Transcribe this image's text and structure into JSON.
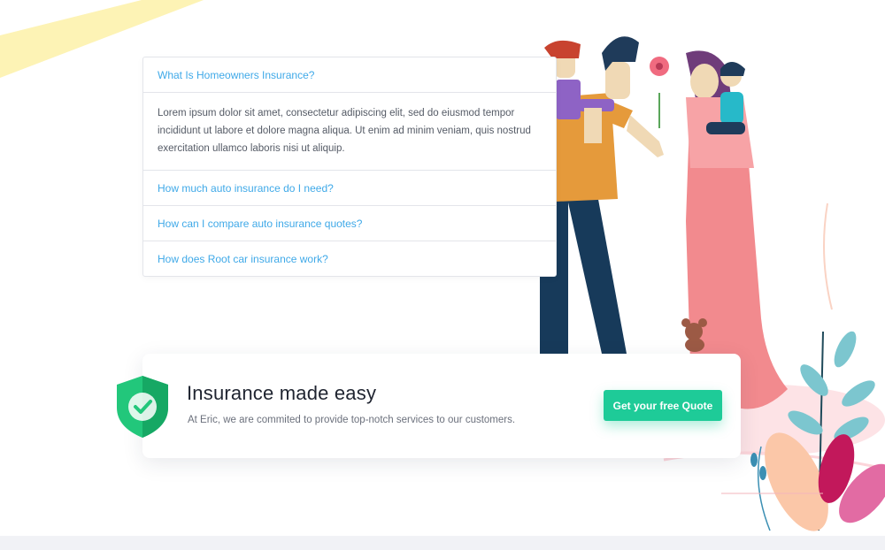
{
  "faq": {
    "items": [
      {
        "question": "What Is Homeowners Insurance?",
        "expanded": true,
        "answer": "Lorem ipsum dolor sit amet, consectetur adipiscing elit, sed do eiusmod tempor incididunt ut labore et dolore magna aliqua. Ut enim ad minim veniam, quis nostrud exercitation ullamco laboris nisi ut aliquip."
      },
      {
        "question": "How much auto insurance do I need?",
        "expanded": false
      },
      {
        "question": "How can I compare auto insurance quotes?",
        "expanded": false
      },
      {
        "question": "How does Root car insurance work?",
        "expanded": false
      }
    ]
  },
  "cta": {
    "title": "Insurance made easy",
    "subtitle": "At Eric, we are commited to provide top-notch services to our customers.",
    "button_label": "Get your free Quote"
  },
  "colors": {
    "accent": "#1ecb98",
    "link": "#3fa9e8",
    "stripe": "#fdf3b5"
  },
  "icons": [
    "shield-check-icon"
  ]
}
